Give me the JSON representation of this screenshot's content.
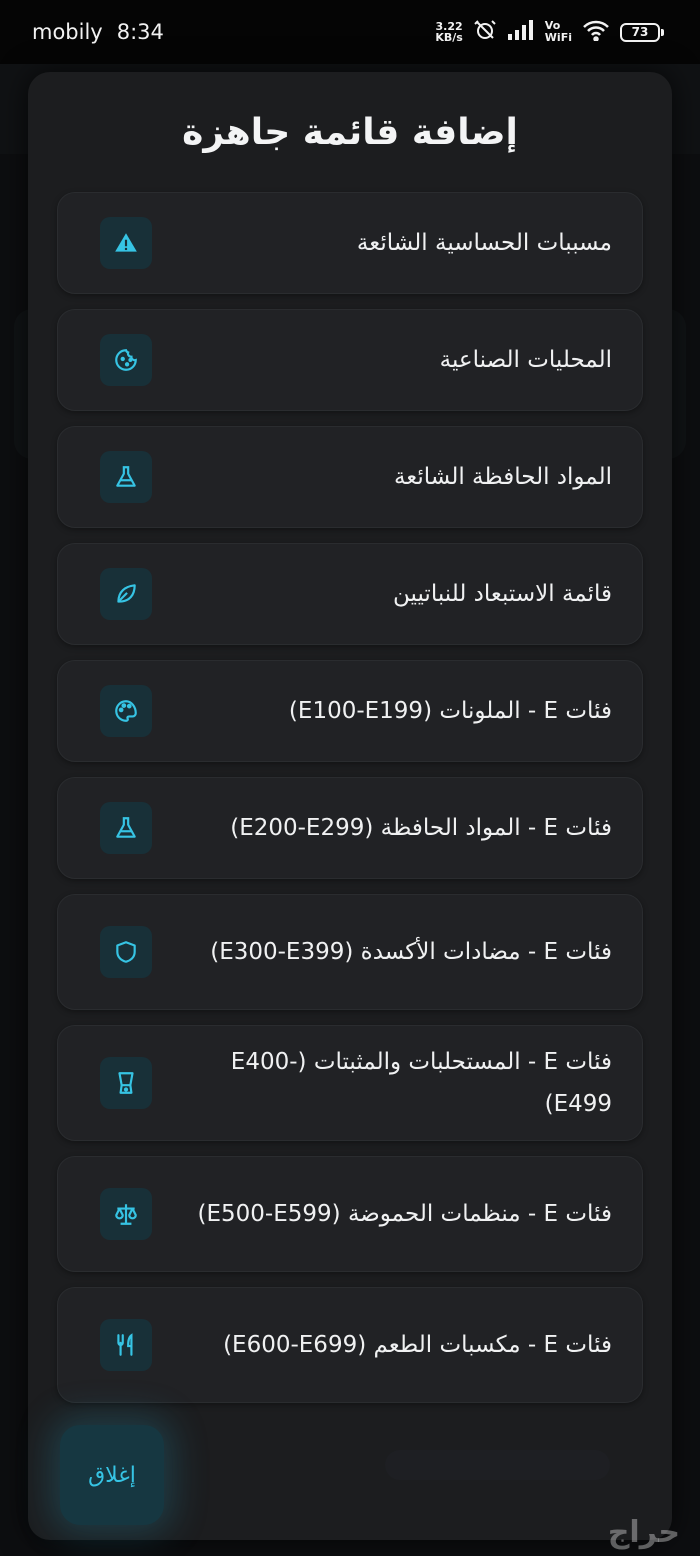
{
  "status_bar": {
    "carrier": "mobily",
    "time": "8:34",
    "net_speed_value": "3.22",
    "net_speed_unit": "KB/s",
    "vowifi_top": "Vo",
    "vowifi_bottom": "WiFi",
    "battery": "73"
  },
  "modal": {
    "title": "إضافة قائمة جاهزة",
    "items": [
      {
        "label": "مسببات الحساسية الشائعة",
        "icon": "warning-icon"
      },
      {
        "label": "المحليات الصناعية",
        "icon": "cookie-icon"
      },
      {
        "label": "المواد الحافظة الشائعة",
        "icon": "flask-icon"
      },
      {
        "label": "قائمة الاستبعاد للنباتيين",
        "icon": "leaf-icon"
      },
      {
        "label": "فئات E - الملونات (E100-E199)",
        "icon": "palette-icon"
      },
      {
        "label": "فئات E - المواد الحافظة (E200-E299)",
        "icon": "flask-icon"
      },
      {
        "label": "فئات E - مضادات الأكسدة (E300-E399)",
        "icon": "shield-icon"
      },
      {
        "label": "فئات E - المستحلبات والمثبتات (E400-E499)",
        "icon": "blender-icon"
      },
      {
        "label": "فئات E - منظمات الحموضة (E500-E599)",
        "icon": "scale-icon"
      },
      {
        "label": "فئات E - مكسبات الطعم (E600-E699)",
        "icon": "utensils-icon"
      }
    ],
    "close_label": "إغلاق"
  },
  "watermark": "حراج",
  "colors": {
    "accent": "#36c4e4",
    "icon_bg": "#183038",
    "item_bg": "#212225",
    "modal_bg": "#1c1d1f"
  }
}
